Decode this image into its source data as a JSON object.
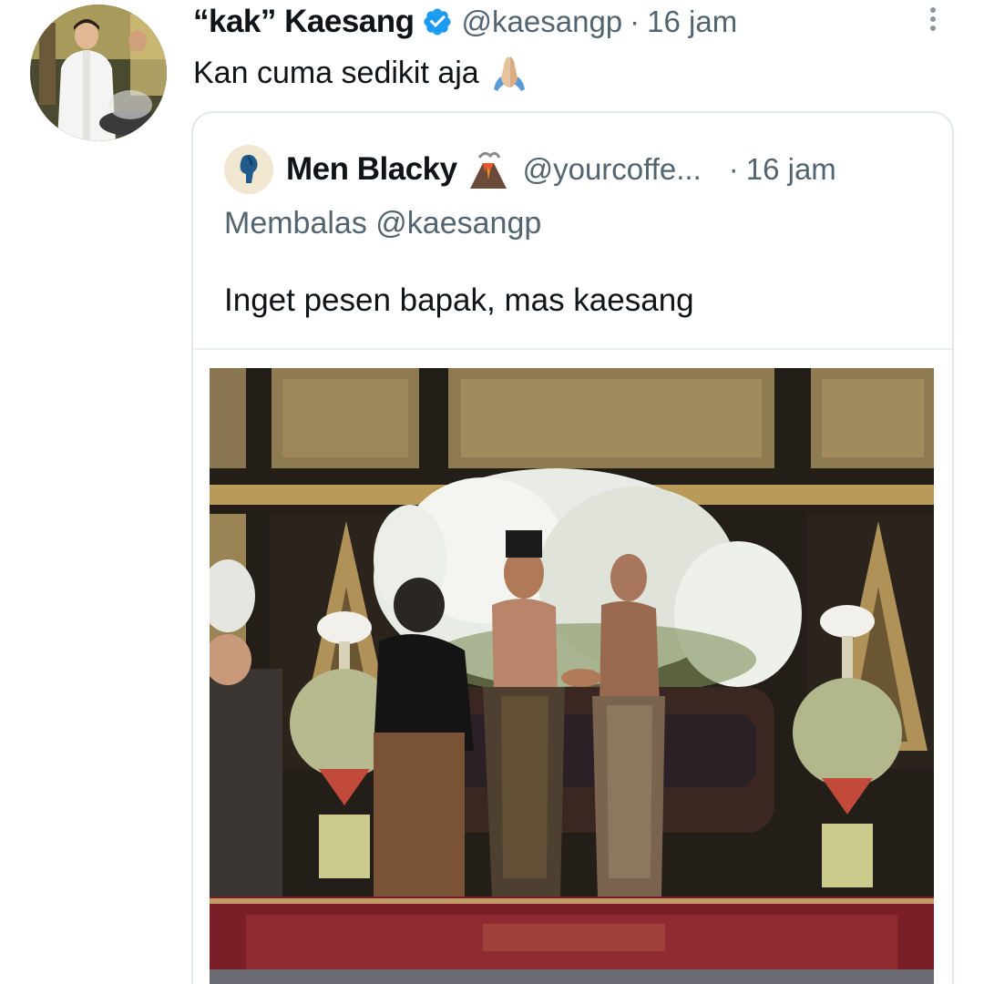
{
  "tweet": {
    "display_name": "“kak” Kaesang",
    "verified": true,
    "handle": "@kaesangp",
    "separator": "·",
    "time": "16 jam",
    "text": "Kan cuma sedikit aja",
    "emoji": "folded-hands-icon"
  },
  "quoted_tweet": {
    "display_name": "Men Blacky",
    "name_emoji": "volcano-icon",
    "handle": "@yourcoffe...",
    "separator": "·",
    "time": "16 jam",
    "reply_label": "Membalas",
    "reply_mention": "@kaesangp",
    "text": "Inget pesen bapak, mas kaesang",
    "media": "photo"
  },
  "colors": {
    "primary_text": "#0f1419",
    "secondary_text": "#536471",
    "verified_blue": "#1d9bf0",
    "border": "#e4e8eb"
  }
}
